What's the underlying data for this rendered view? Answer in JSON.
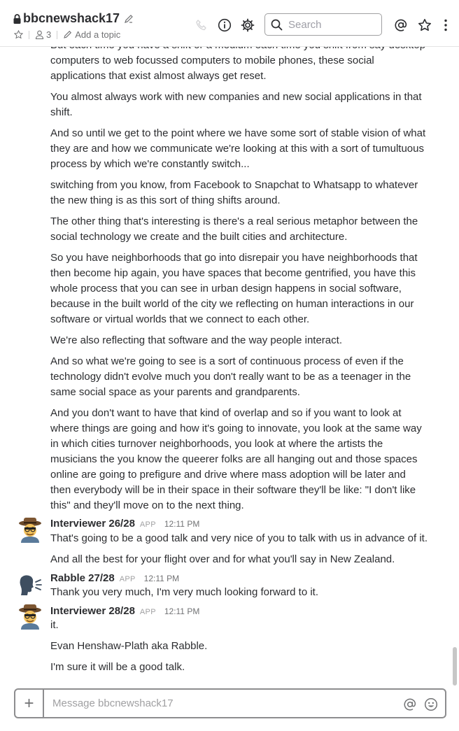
{
  "header": {
    "channel_name": "bbcnewshack17",
    "member_count": "3",
    "add_topic": "Add a topic",
    "search_placeholder": "Search"
  },
  "messages": {
    "continued_paragraphs": [
      "But each time you have a shift or a medium each time you shift from say desktop computers to web focussed computers to mobile phones, these social applications that exist almost always get reset.",
      "You almost always work with new companies and new social applications in that shift.",
      "And so until we get to the point where we have some sort of stable vision of what they are and how we communicate we're looking at this with a sort of tumultuous process by which we're constantly switch...",
      "switching from you know, from Facebook to Snapchat to Whatsapp to whatever the new thing is as this sort of thing shifts around.",
      "The other thing that's interesting is there's a real serious metaphor between the social technology we create and the built cities and architecture.",
      "So you have neighborhoods that go into disrepair you have neighborhoods that then become hip again, you have spaces that become gentrified, you have this whole process that you can see in urban design happens in social software, because in the built world of the city we reflecting on human interactions in our software or virtual worlds that we connect to each other.",
      "We're also reflecting that software and the way people interact.",
      "And so what we're going to see is a sort of continuous process of even if the technology didn't evolve much you don't really want to be as a teenager in the same social space as your parents and grandparents.",
      "And you don't want to have that kind of overlap and so if you want to look at where things are going and how it's going to innovate, you look at the same way in which cities turnover neighborhoods, you look at where the artists the musicians the you know the queerer folks are all hanging out and those spaces online are going to prefigure and drive where mass adoption will be later and then everybody will be in their space in their software they'll be like: \"I don't like this\" and they'll move on to the next thing."
    ],
    "groups": [
      {
        "author": "Interviewer 26/28",
        "badge": "APP",
        "time": "12:11 PM",
        "lines": [
          "That's going to be a good talk and very nice of you to talk with us in advance of it.",
          "And all the best for your flight over and for what you'll say in New Zealand."
        ]
      },
      {
        "author": "Rabble 27/28",
        "badge": "APP",
        "time": "12:11 PM",
        "lines": [
          "Thank you very much, I'm very much looking forward to it."
        ]
      },
      {
        "author": "Interviewer 28/28",
        "badge": "APP",
        "time": "12:11 PM",
        "lines": [
          "it.",
          "Evan Henshaw-Plath aka Rabble.",
          "I'm sure it will be a good talk."
        ]
      }
    ]
  },
  "composer": {
    "placeholder": "Message bbcnewshack17",
    "plus": "+"
  },
  "colors": {
    "text": "#2c2d30",
    "muted": "#717274",
    "border": "#8d8d8f"
  }
}
